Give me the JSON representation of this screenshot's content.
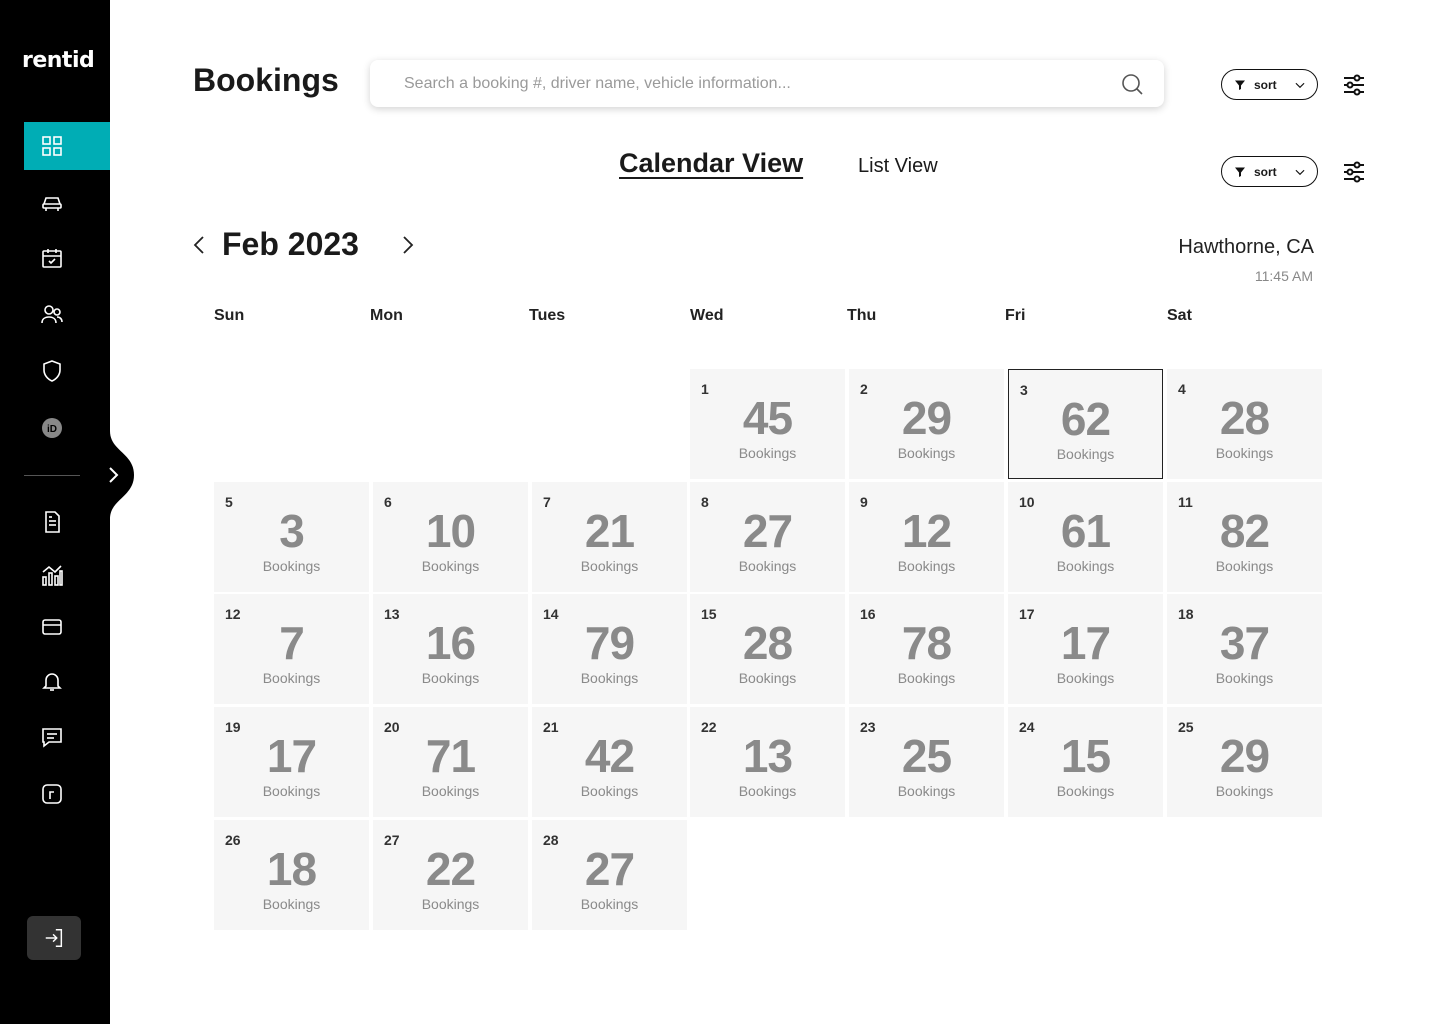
{
  "app": {
    "logo": "rentid"
  },
  "sidebar": {
    "items": [
      {
        "name": "dashboard-icon",
        "active": true
      },
      {
        "name": "car-icon"
      },
      {
        "name": "calendar-check-icon"
      },
      {
        "name": "users-icon"
      },
      {
        "name": "shield-icon"
      },
      {
        "name": "id-badge-icon"
      },
      {
        "name": "document-icon"
      },
      {
        "name": "analytics-icon"
      },
      {
        "name": "credit-card-icon"
      },
      {
        "name": "bell-icon"
      },
      {
        "name": "chat-icon"
      },
      {
        "name": "r-badge-icon"
      }
    ],
    "accent": "#00adb5"
  },
  "header": {
    "title": "Bookings",
    "search_placeholder": "Search a booking #, driver name, vehicle information...",
    "sort_label": "sort"
  },
  "tabs": {
    "calendar": "Calendar View",
    "list": "List View",
    "active": "calendar",
    "sort_label": "sort"
  },
  "calendar": {
    "month": "Feb 2023",
    "location": "Hawthorne, CA",
    "time": "11:45 AM",
    "weekdays": [
      "Sun",
      "Mon",
      "Tues",
      "Wed",
      "Thu",
      "Fri",
      "Sat"
    ],
    "first_weekday_index": 3,
    "selected_day": 3,
    "unit_label": "Bookings",
    "days": [
      {
        "day": "1",
        "count": "45"
      },
      {
        "day": "2",
        "count": "29"
      },
      {
        "day": "3",
        "count": "62"
      },
      {
        "day": "4",
        "count": "28"
      },
      {
        "day": "5",
        "count": "3"
      },
      {
        "day": "6",
        "count": "10"
      },
      {
        "day": "7",
        "count": "21"
      },
      {
        "day": "8",
        "count": "27"
      },
      {
        "day": "9",
        "count": "12"
      },
      {
        "day": "10",
        "count": "61"
      },
      {
        "day": "11",
        "count": "82"
      },
      {
        "day": "12",
        "count": "7"
      },
      {
        "day": "13",
        "count": "16"
      },
      {
        "day": "14",
        "count": "79"
      },
      {
        "day": "15",
        "count": "28"
      },
      {
        "day": "16",
        "count": "78"
      },
      {
        "day": "17",
        "count": "17"
      },
      {
        "day": "18",
        "count": "37"
      },
      {
        "day": "19",
        "count": "17"
      },
      {
        "day": "20",
        "count": "71"
      },
      {
        "day": "21",
        "count": "42"
      },
      {
        "day": "22",
        "count": "13"
      },
      {
        "day": "23",
        "count": "25"
      },
      {
        "day": "24",
        "count": "15"
      },
      {
        "day": "25",
        "count": "29"
      },
      {
        "day": "26",
        "count": "18"
      },
      {
        "day": "27",
        "count": "22"
      },
      {
        "day": "28",
        "count": "27"
      }
    ]
  }
}
